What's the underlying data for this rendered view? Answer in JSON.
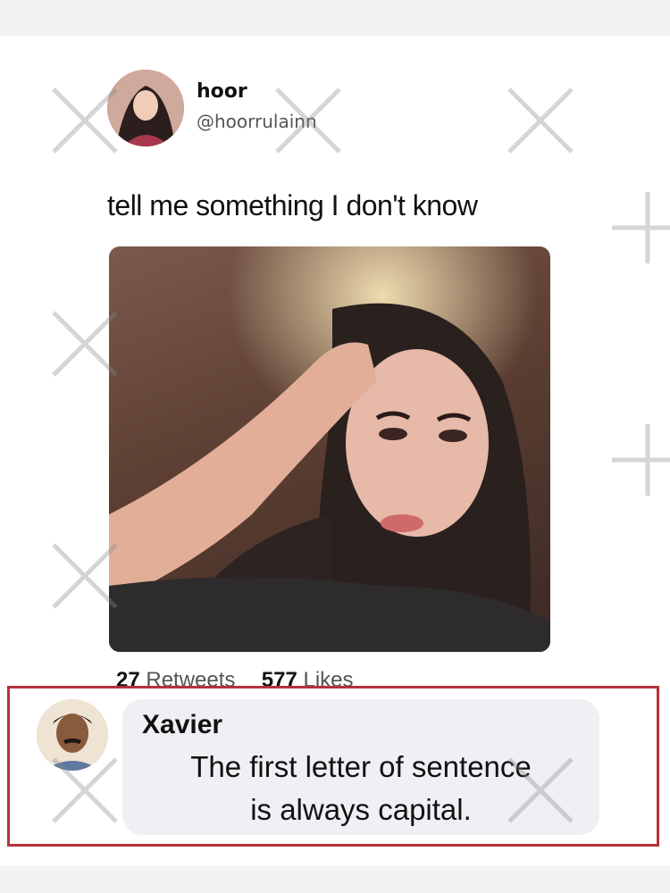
{
  "tweet": {
    "author_name": "hoor",
    "author_handle": "@hoorrulainn",
    "text": "tell me something I don't know",
    "retweet_count": "27",
    "retweet_label": "Retweets",
    "like_count": "577",
    "like_label": "Likes"
  },
  "reply": {
    "author_name": "Xavier",
    "text_line1": "The first letter of sentence",
    "text_line2": "is always capital."
  },
  "colors": {
    "reply_border": "#b5323a",
    "bubble_bg": "#eef0f4"
  }
}
